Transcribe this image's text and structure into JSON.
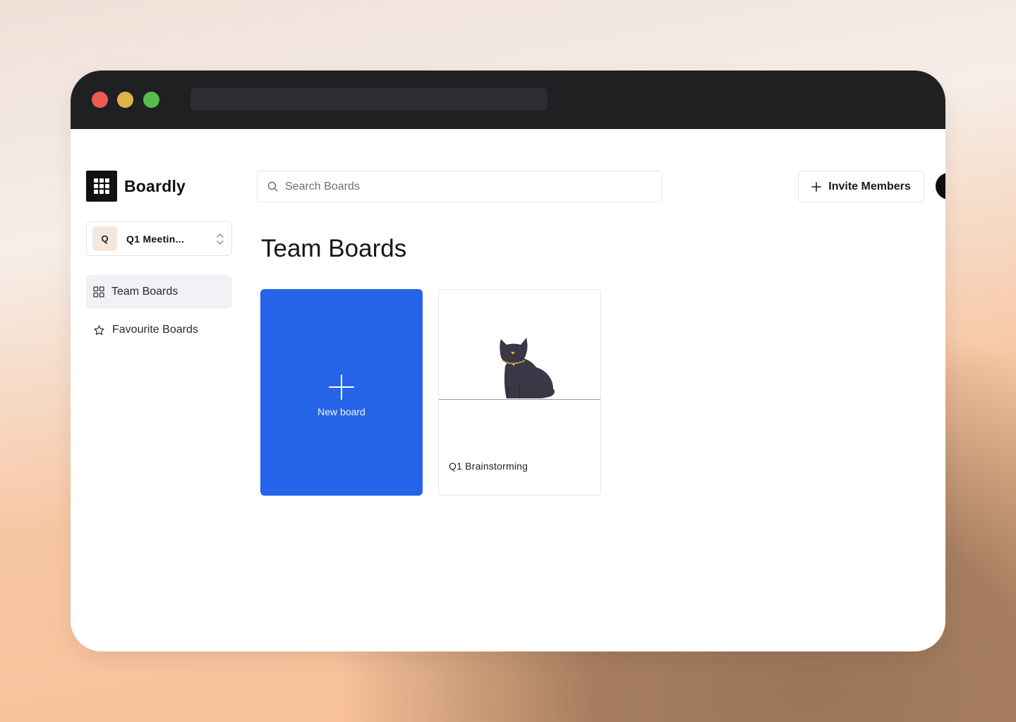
{
  "app": {
    "name": "Boardly"
  },
  "workspace": {
    "badge": "Q",
    "name": "Q1 Meetin..."
  },
  "sidebar": {
    "items": [
      {
        "label": "Team Boards",
        "icon": "grid-icon",
        "active": true
      },
      {
        "label": "Favourite Boards",
        "icon": "star-icon",
        "active": false
      }
    ]
  },
  "header": {
    "search_placeholder": "Search Boards",
    "invite_label": "Invite Members"
  },
  "main": {
    "title": "Team Boards",
    "new_board_label": "New board",
    "boards": [
      {
        "name": "Q1 Brainstorming",
        "thumbnail": "cat-illustration"
      }
    ]
  },
  "colors": {
    "accent": "#2563e8",
    "titlebar": "#1f2022",
    "traffic_red": "#ee5a52",
    "traffic_yellow": "#e0b449",
    "traffic_green": "#57bd4a"
  }
}
